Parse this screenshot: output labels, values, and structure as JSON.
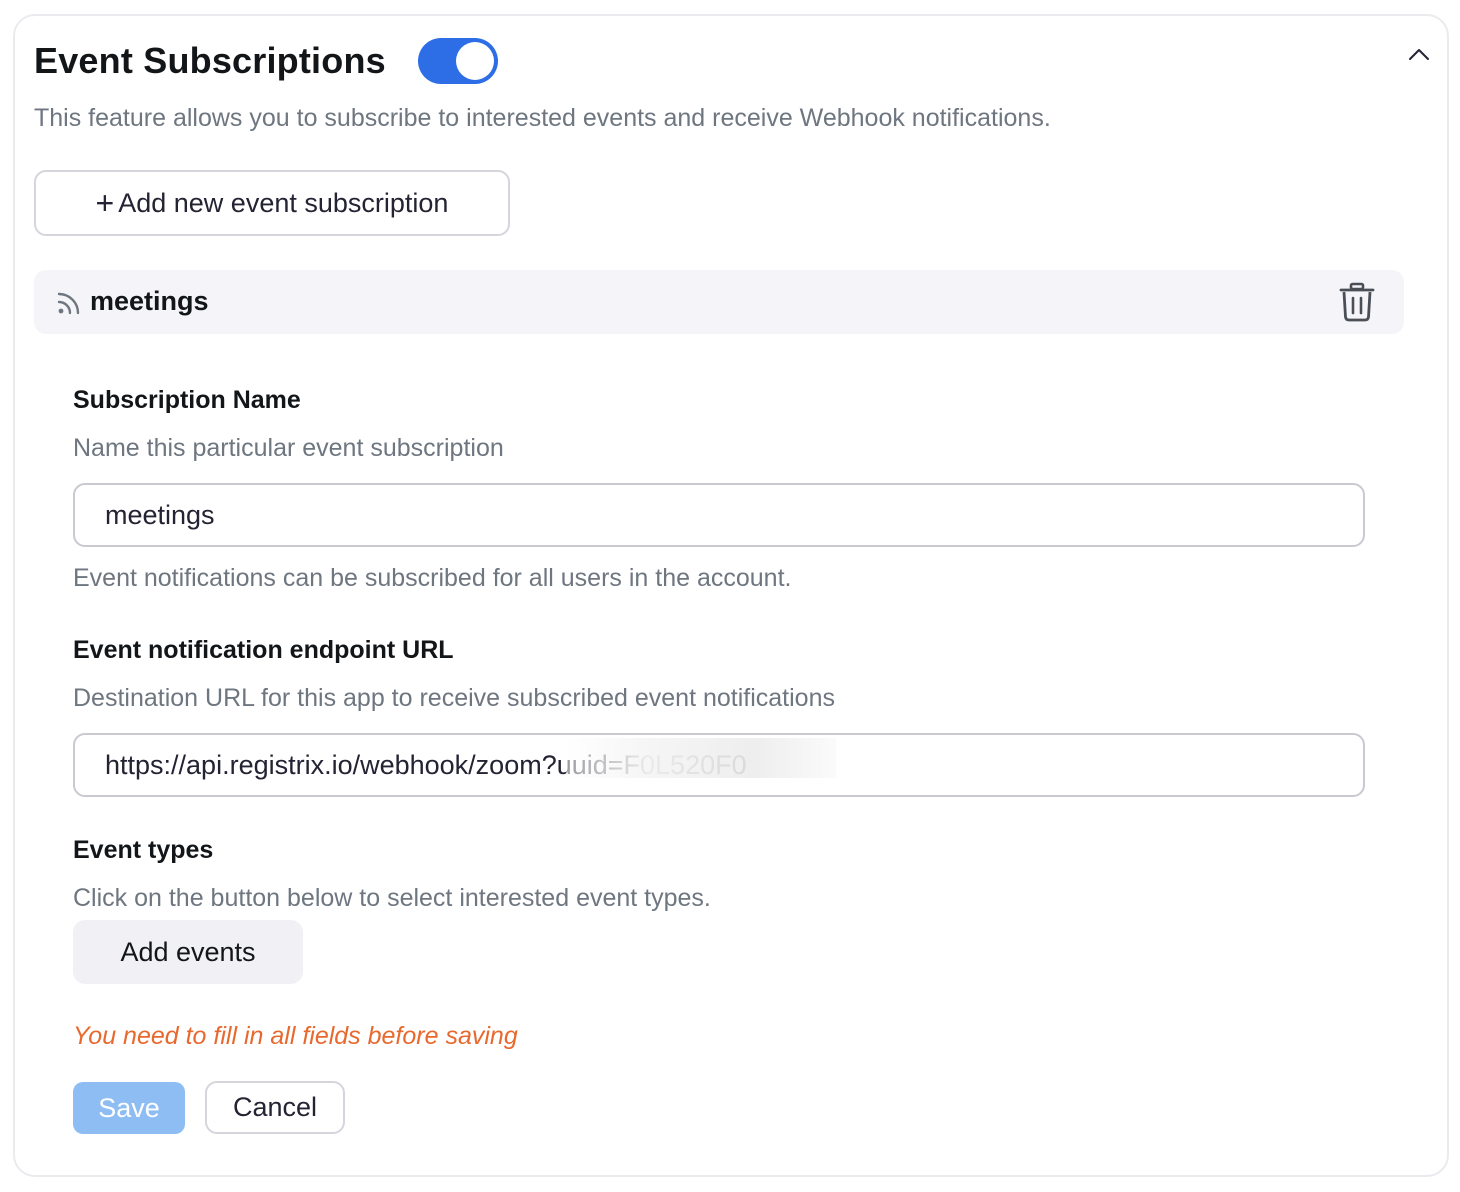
{
  "header": {
    "title": "Event Subscriptions",
    "toggle_on": true,
    "description": "This feature allows you to subscribe to interested events and receive Webhook notifications.",
    "collapse_icon": "chevron-up-icon"
  },
  "add_subscription": {
    "icon": "plus-icon",
    "label": "Add new event subscription"
  },
  "subscription": {
    "icon": "rss-feed-icon",
    "title": "meetings",
    "delete_icon": "trash-icon"
  },
  "form": {
    "name": {
      "label": "Subscription Name",
      "help": "Name this particular event subscription",
      "value": "meetings",
      "note": "Event notifications can be subscribed for all users in the account."
    },
    "endpoint": {
      "label": "Event notification endpoint URL",
      "help": "Destination URL for this app to receive subscribed event notifications",
      "value": "https://api.registrix.io/webhook/zoom?uuid=F0L520F0"
    },
    "event_types": {
      "label": "Event types",
      "help": "Click on the button below to select interested event types.",
      "button": "Add events"
    }
  },
  "warning": "You need to fill in all fields before saving",
  "actions": {
    "save": "Save",
    "cancel": "Cancel"
  },
  "colors": {
    "accent": "#2d6ee6",
    "save_disabled": "#8ebdf4",
    "warning": "#e8692e"
  }
}
